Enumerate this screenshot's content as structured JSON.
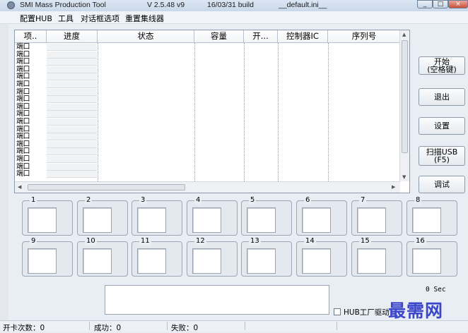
{
  "window": {
    "app_name": "SMI Mass Production Tool",
    "version": "V 2.5.48   v9",
    "build": "16/03/31 build",
    "ini": "__default.ini__"
  },
  "menu": [
    "配置HUB",
    "工具",
    "对话框选项",
    "重置集线器"
  ],
  "list": {
    "columns": [
      "项..",
      "进度",
      "状态",
      "容量",
      "开...",
      "控制器IC",
      "序列号"
    ],
    "row_label": "端口",
    "row_count": 18
  },
  "side_buttons": {
    "start": "开始\n(空格键)",
    "exit": "退出",
    "settings": "设置",
    "scan": "扫描USB\n(F5)",
    "debug": "调试"
  },
  "ports": [
    "1",
    "2",
    "3",
    "4",
    "5",
    "6",
    "7",
    "8",
    "9",
    "10",
    "11",
    "12",
    "13",
    "14",
    "15",
    "16"
  ],
  "timer": "0 Sec",
  "hub_driver_label": "HUB工厂驱动",
  "watermark": "最需网",
  "status": {
    "open_count": "开卡次数：0",
    "success": "成功：0",
    "fail": "失败：0"
  }
}
